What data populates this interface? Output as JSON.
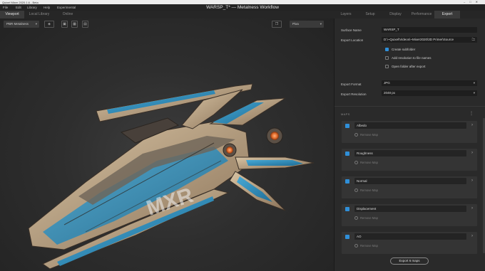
{
  "window": {
    "app_name": "Quixel Mixer 2020.1.6 - Beta",
    "title": "WARSP_T* — Metalness Workflow"
  },
  "menu": [
    "File",
    "Edit",
    "Library",
    "Help",
    "Experimental"
  ],
  "left_tabs": [
    "Viewport",
    "Local Library",
    "Online"
  ],
  "right_tabs": [
    "Layers",
    "Setup",
    "Display",
    "Performance",
    "Export"
  ],
  "viewport": {
    "render_mode": "PBR Metalness",
    "view_mode": "Pixa"
  },
  "export": {
    "surface_name_label": "Surface Name",
    "surface_name_value": "WARSP_T",
    "export_location_label": "Export Location",
    "export_location_value": "D:\\~Quixel\\Videos\\~Mixer2020\\3D Primer\\Source",
    "options": [
      {
        "label": "Create subfolder",
        "checked": true
      },
      {
        "label": "Add resolution to file names",
        "checked": false
      },
      {
        "label": "Open folder after export",
        "checked": false
      }
    ],
    "format_label": "Export Format",
    "format_value": "JPG",
    "resolution_label": "Export Resolution",
    "resolution_value": "2048 px"
  },
  "maps": {
    "header": "MAPS",
    "remove_label": "Remove Map",
    "items": [
      {
        "name": "Albedo",
        "checked": true
      },
      {
        "name": "Roughness",
        "checked": true
      },
      {
        "name": "Normal",
        "checked": true
      },
      {
        "name": "Displacement",
        "checked": true
      },
      {
        "name": "AO",
        "checked": true
      }
    ]
  },
  "export_button": "Export 6 maps",
  "model_decal": "MXR",
  "colors": {
    "accent": "#2f8fd8",
    "panel_bg": "#2a2a2a",
    "viewport_bg": "#2e2e2e",
    "hull_blue": "#2c88b6",
    "hull_tan": "#b9a283",
    "engine_orange": "#e06a2a"
  }
}
